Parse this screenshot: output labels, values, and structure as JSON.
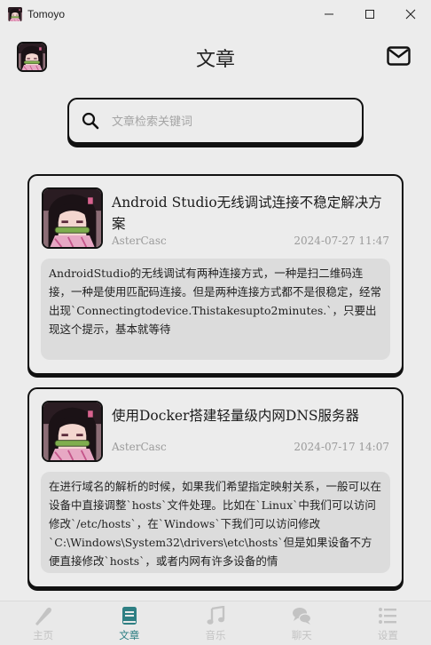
{
  "window": {
    "title": "Tomoyo",
    "controls": [
      "minimize-icon",
      "maximize-icon",
      "close-icon"
    ]
  },
  "header": {
    "title": "文章",
    "mail_icon": "mail-icon"
  },
  "search": {
    "placeholder": "文章检索关键词",
    "icon": "search-icon"
  },
  "articles": [
    {
      "title": "Android Studio无线调试连接不稳定解决方案",
      "author": "AsterCasc",
      "date": "2024-07-27 11:47",
      "excerpt": "AndroidStudio的无线调试有两种连接方式，一种是扫二维码连接，一种是使用匹配码连接。但是两种连接方式都不是很稳定，经常出现`Connectingtodevice.Thistakesupto2minutes.`，只要出现这个提示，基本就等待"
    },
    {
      "title": "使用Docker搭建轻量级内网DNS服务器",
      "author": "AsterCasc",
      "date": "2024-07-17 14:07",
      "excerpt": "在进行域名的解析的时候，如果我们希望指定映射关系，一般可以在设备中直接调整`hosts`文件处理。比如在`Linux`中我们可以访问修改`/etc/hosts`，在`Windows`下我们可以访问修改`C:\\Windows\\System32\\drivers\\etc\\hosts`但是如果设备不方便直接修改`hosts`，或者内网有许多设备的情"
    }
  ],
  "nav": {
    "items": [
      {
        "label": "主页",
        "icon": "baseball-bat-icon"
      },
      {
        "label": "文章",
        "icon": "book-icon"
      },
      {
        "label": "音乐",
        "icon": "music-note-icon"
      },
      {
        "label": "聊天",
        "icon": "chat-bubbles-icon"
      },
      {
        "label": "设置",
        "icon": "list-icon"
      }
    ],
    "active_index": 1
  },
  "colors": {
    "background": "#ececec",
    "border": "#111111",
    "excerpt_bg": "#dcdcdc",
    "accent": "#2e7f83",
    "nav_inactive": "#c3c3c3",
    "muted_text": "#9a9a9a"
  }
}
